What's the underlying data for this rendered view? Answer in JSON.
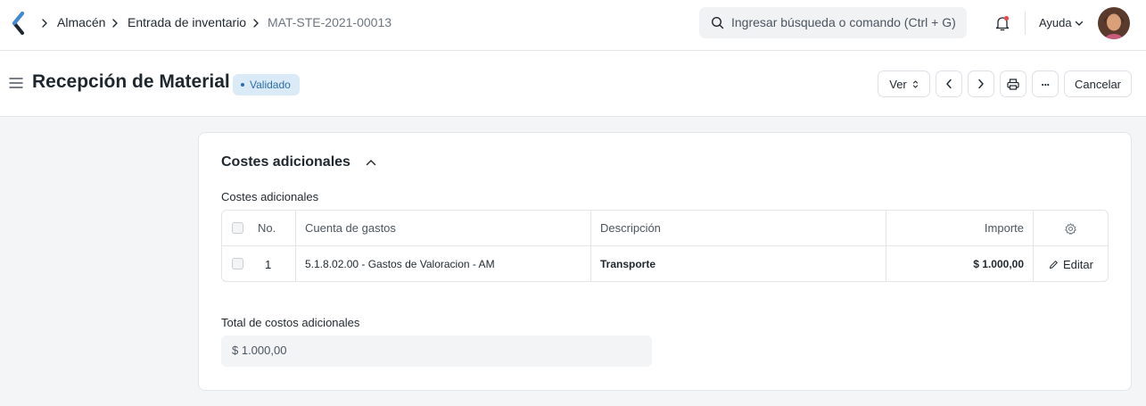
{
  "breadcrumbs": {
    "items": [
      "Almacén",
      "Entrada de inventario",
      "MAT-STE-2021-00013"
    ]
  },
  "search": {
    "placeholder": "Ingresar búsqueda o comando (Ctrl + G)"
  },
  "navbar": {
    "help_label": "Ayuda"
  },
  "page": {
    "title": "Recepción de Material",
    "status": "Validado",
    "view_button": "Ver",
    "more_label": "...",
    "cancel_button": "Cancelar"
  },
  "section": {
    "title": "Costes adicionales",
    "table_label": "Costes adicionales",
    "columns": {
      "no": "No.",
      "account": "Cuenta de gastos",
      "description": "Descripción",
      "amount": "Importe"
    },
    "rows": [
      {
        "no": "1",
        "account": "5.1.8.02.00 - Gastos de Valoracion - AM",
        "description": "Transporte",
        "amount": "$ 1.000,00",
        "edit_label": "Editar"
      }
    ],
    "total_label": "Total de costos adicionales",
    "total_value": "$ 1.000,00"
  },
  "colors": {
    "accent": "#2c6ea8",
    "badge_bg": "#dbeaf7",
    "page_bg": "#f4f5f6"
  }
}
